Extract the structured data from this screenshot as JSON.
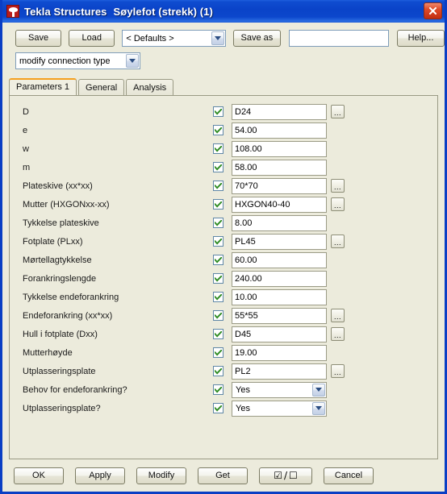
{
  "window": {
    "app_title": "Tekla Structures",
    "doc_title": "Søylefot (strekk) (1)",
    "close_label": "×",
    "app_icon": "tekla-logo-icon"
  },
  "toolbar": {
    "save_label": "Save",
    "load_label": "Load",
    "attribute_file": "< Defaults >",
    "save_as_label": "Save as",
    "save_as_value": "",
    "save_as_placeholder": "",
    "help_label": "Help...",
    "mode_value": "modify connection type"
  },
  "tabs": [
    {
      "label": "Parameters 1",
      "active": true
    },
    {
      "label": "General",
      "active": false
    },
    {
      "label": "Analysis",
      "active": false
    }
  ],
  "parameters": [
    {
      "label": "D",
      "checked": true,
      "value": "D24",
      "type": "text",
      "browse": true
    },
    {
      "label": "e",
      "checked": true,
      "value": "54.00",
      "type": "text",
      "browse": false
    },
    {
      "label": "w",
      "checked": true,
      "value": "108.00",
      "type": "text",
      "browse": false
    },
    {
      "label": "m",
      "checked": true,
      "value": "58.00",
      "type": "text",
      "browse": false
    },
    {
      "label": "Plateskive (xx*xx)",
      "checked": true,
      "value": "70*70",
      "type": "text",
      "browse": true
    },
    {
      "label": "Mutter (HXGONxx-xx)",
      "checked": true,
      "value": "HXGON40-40",
      "type": "text",
      "browse": true
    },
    {
      "label": "Tykkelse plateskive",
      "checked": true,
      "value": "8.00",
      "type": "text",
      "browse": false
    },
    {
      "label": "Fotplate (PLxx)",
      "checked": true,
      "value": "PL45",
      "type": "text",
      "browse": true
    },
    {
      "label": "Mørtellagtykkelse",
      "checked": true,
      "value": "60.00",
      "type": "text",
      "browse": false
    },
    {
      "label": "Forankringslengde",
      "checked": true,
      "value": "240.00",
      "type": "text",
      "browse": false
    },
    {
      "label": "Tykkelse endeforankring",
      "checked": true,
      "value": "10.00",
      "type": "text",
      "browse": false
    },
    {
      "label": "Endeforankring (xx*xx)",
      "checked": true,
      "value": "55*55",
      "type": "text",
      "browse": true
    },
    {
      "label": "Hull i fotplate (Dxx)",
      "checked": true,
      "value": "D45",
      "type": "text",
      "browse": true
    },
    {
      "label": "Mutterhøyde",
      "checked": true,
      "value": "19.00",
      "type": "text",
      "browse": false
    },
    {
      "label": "Utplasseringsplate",
      "checked": true,
      "value": "PL2",
      "type": "text",
      "browse": true
    },
    {
      "label": "Behov for endeforankring?",
      "checked": true,
      "value": "Yes",
      "type": "select",
      "browse": false
    },
    {
      "label": "Utplasseringsplate?",
      "checked": true,
      "value": "Yes",
      "type": "select",
      "browse": false
    }
  ],
  "footer": {
    "ok_label": "OK",
    "apply_label": "Apply",
    "modify_label": "Modify",
    "get_label": "Get",
    "toggle_checked_symbol": "☑",
    "toggle_separator": "/",
    "toggle_unchecked_symbol": "☐",
    "cancel_label": "Cancel"
  },
  "colors": {
    "titlebar_blue": "#0A43C8",
    "dialog_beige": "#ECEBDC",
    "check_green": "#2E8B22",
    "active_tab_accent": "#F5A01E",
    "close_red": "#C12D10"
  }
}
